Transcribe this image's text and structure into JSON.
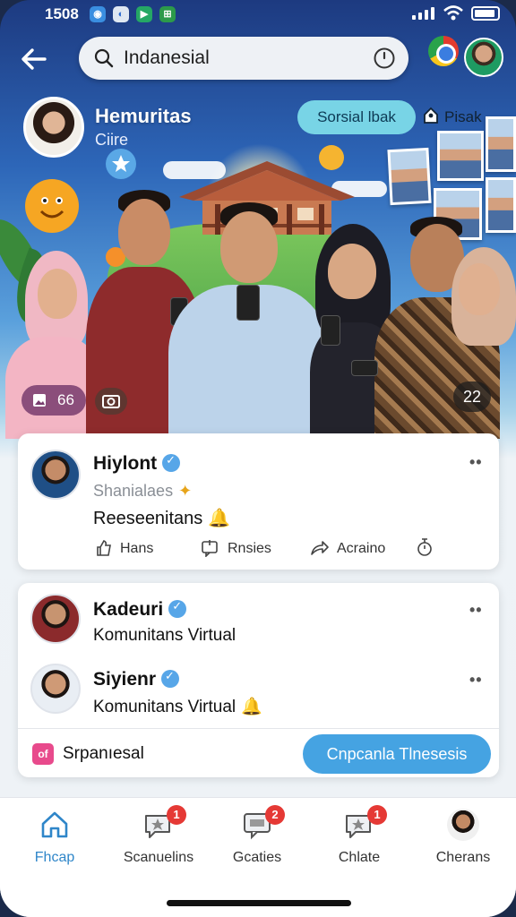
{
  "status_bar": {
    "time": "1508"
  },
  "header": {
    "search_value": "Indanesial",
    "back_icon": "back-arrow-icon",
    "clock_icon": "clock-icon"
  },
  "hero": {
    "title": "Hemuritas",
    "subtitle": "Ciire",
    "social_pill": "Sorsial lbak",
    "tag_label": "Pisak",
    "photo_count": "66",
    "corner_count": "22"
  },
  "post": {
    "author": "Hiylont",
    "handle": "Shanialaes",
    "text": "Reeseenitans",
    "actions": [
      {
        "label": "Hans",
        "icon": "like-icon"
      },
      {
        "label": "Rnsies",
        "icon": "comment-icon"
      },
      {
        "label": "Acraino",
        "icon": "share-icon"
      }
    ]
  },
  "communities": {
    "items": [
      {
        "name": "Kadeuri",
        "subtitle": "Komunitans Virtual"
      },
      {
        "name": "Siyienr",
        "subtitle": "Komunitans Virtual"
      }
    ],
    "footer_icon_text": "of",
    "footer_label": "Srpanıesal",
    "cta_label": "Cnpcanla Tlnesesis"
  },
  "bottom_nav": {
    "items": [
      {
        "label": "Fhcap",
        "icon": "home-icon",
        "badge": ""
      },
      {
        "label": "Scanuelins",
        "icon": "chat-icon",
        "badge": "1"
      },
      {
        "label": "Gcaties",
        "icon": "message-icon",
        "badge": "2"
      },
      {
        "label": "Chlate",
        "icon": "chat-bubble-icon",
        "badge": "1"
      },
      {
        "label": "Cherans",
        "icon": "profile-avatar-icon",
        "badge": ""
      }
    ]
  },
  "colors": {
    "accent": "#45a3e2",
    "badge": "#e53935",
    "active_nav": "#2f86c9"
  }
}
